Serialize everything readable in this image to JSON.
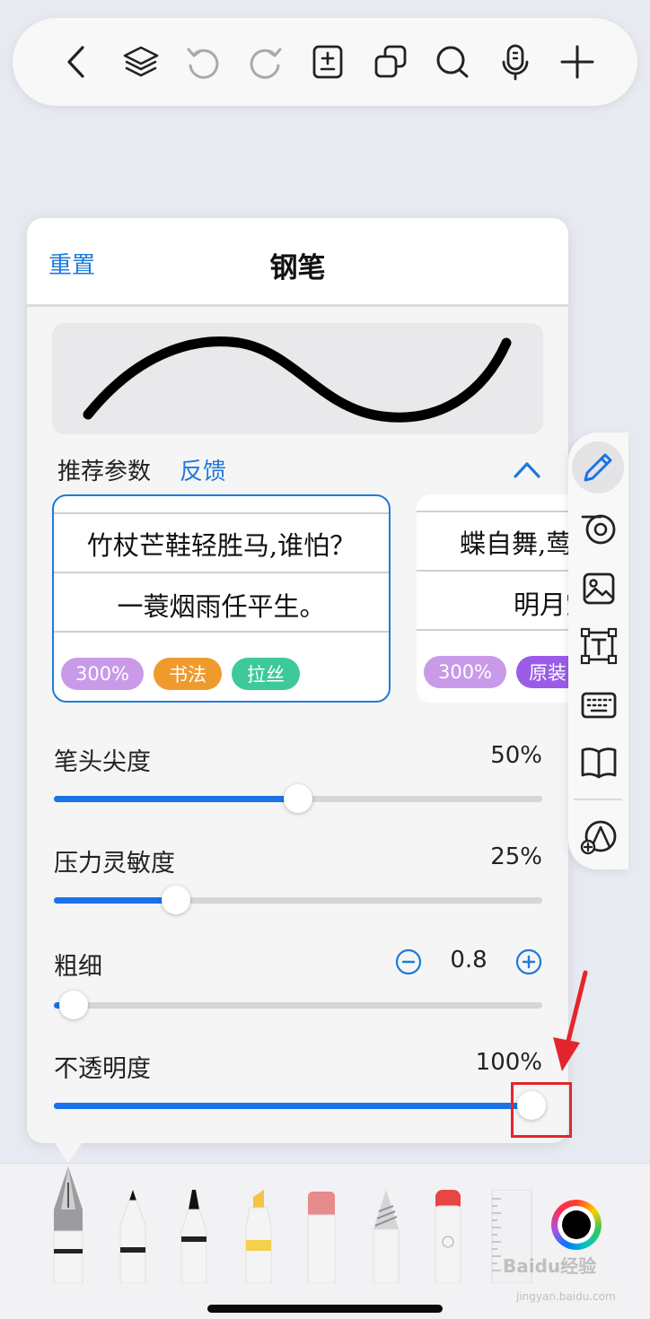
{
  "toolbar": {
    "icons": [
      "back-icon",
      "layers-icon",
      "undo-icon",
      "redo-icon",
      "page-add-icon",
      "copy-icon",
      "search-icon",
      "microphone-icon",
      "plus-icon"
    ]
  },
  "panel": {
    "reset": "重置",
    "title": "钢笔",
    "recommended_label": "推荐参数",
    "feedback": "反馈",
    "presets": [
      {
        "line1": "竹杖芒鞋轻胜马,谁怕？",
        "line2": "一蓑烟雨任平生。",
        "tags": [
          {
            "label": "300%",
            "color": "#c89ae8"
          },
          {
            "label": "书法",
            "color": "#ef9a2d"
          },
          {
            "label": "拉丝",
            "color": "#3ec99a"
          }
        ]
      },
      {
        "line1": "蝶自舞,莺自",
        "line2": "明月空",
        "tags": [
          {
            "label": "300%",
            "color": "#c89ae8"
          },
          {
            "label": "原装",
            "color": "#9b5ce8"
          }
        ]
      }
    ],
    "sliders": {
      "tip_sharpness": {
        "label": "笔头尖度",
        "value_text": "50%",
        "fraction": 0.5
      },
      "pressure": {
        "label": "压力灵敏度",
        "value_text": "25%",
        "fraction": 0.25
      },
      "thickness": {
        "label": "粗细",
        "value_text": "0.8",
        "fraction": 0.04
      },
      "opacity": {
        "label": "不透明度",
        "value_text": "100%",
        "fraction": 1.0
      }
    }
  },
  "side_toolbar": {
    "icons": [
      "pen-icon",
      "tape-icon",
      "image-icon",
      "textbox-icon",
      "keyboard-icon",
      "book-icon",
      "shapes-icon"
    ]
  },
  "tray": {
    "tools": [
      "fountain-pen",
      "ballpoint-pen",
      "marker",
      "highlighter",
      "eraser",
      "pencil",
      "brush",
      "ruler"
    ],
    "current_color": "#000000"
  },
  "watermark": {
    "brand": "Baidu经验",
    "url": "jingyan.baidu.com"
  },
  "colors": {
    "accent": "#1f7ad9",
    "slider_fill": "#1a73e8",
    "annotation": "#e3262b"
  }
}
